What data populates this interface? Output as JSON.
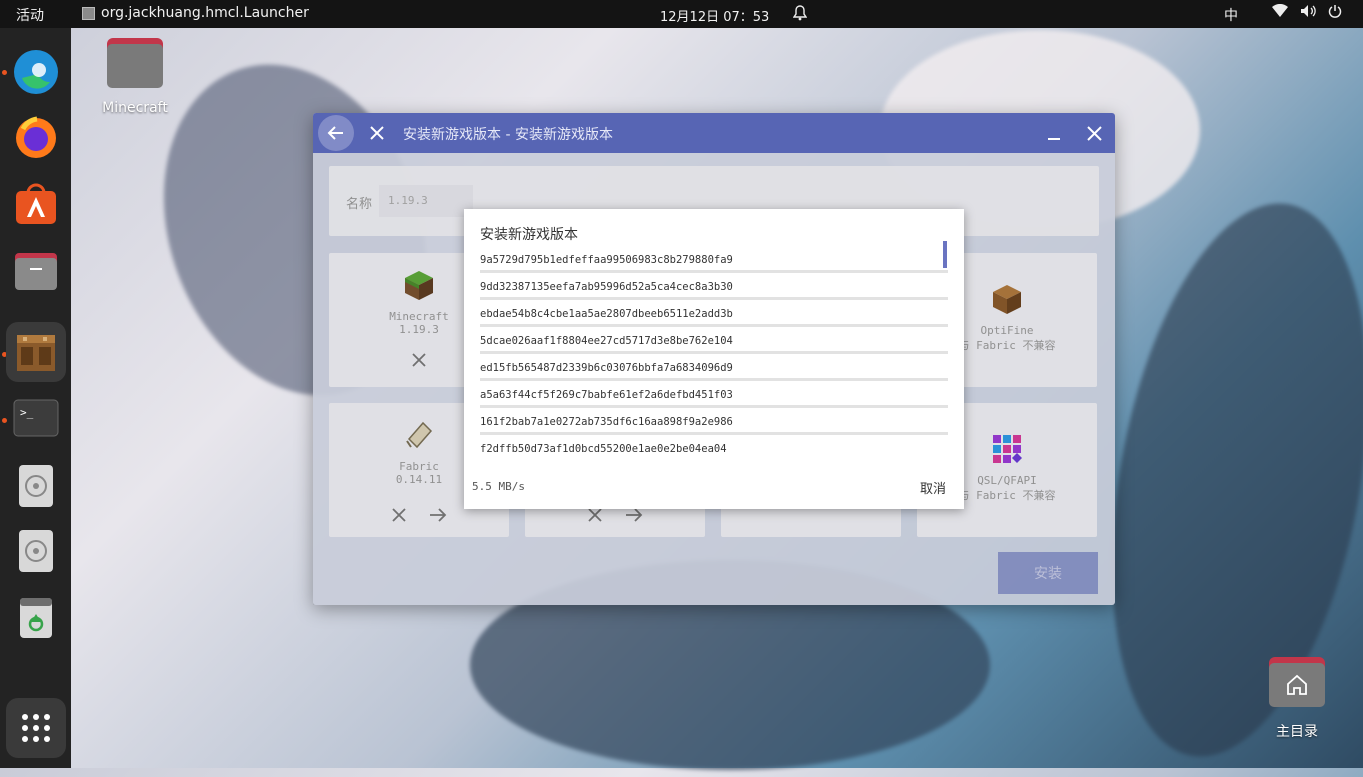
{
  "topbar": {
    "activities": "活动",
    "app_name": "org.jackhuang.hmcl.Launcher",
    "clock": "12月12日 07：53",
    "ime": "中"
  },
  "dock": {
    "items": [
      {
        "name": "edge",
        "running": true
      },
      {
        "name": "firefox",
        "running": false
      },
      {
        "name": "app-center",
        "running": false
      },
      {
        "name": "files",
        "running": false
      },
      {
        "name": "hmcl-launcher",
        "running": true
      },
      {
        "name": "terminal",
        "running": true
      },
      {
        "name": "disc-1",
        "running": false
      },
      {
        "name": "disc-2",
        "running": false
      },
      {
        "name": "trash",
        "running": false
      },
      {
        "name": "show-apps",
        "running": false
      }
    ]
  },
  "desktop": {
    "minecraft_label": "Minecraft",
    "home_label": "主目录"
  },
  "window": {
    "title": "安装新游戏版本 - 安装新游戏版本",
    "name_label": "名称",
    "name_value": "1.19.3",
    "cards": {
      "minecraft": {
        "name": "Minecraft",
        "version": "1.19.3"
      },
      "optifine": {
        "name": "OptiFine",
        "note": "与 Fabric 不兼容"
      },
      "fabric": {
        "name": "Fabric",
        "version": "0.14.11"
      },
      "qsl": {
        "name": "QSL/QFAPI",
        "note": "与 Fabric 不兼容"
      }
    },
    "install_label": "安装"
  },
  "dialog": {
    "title": "安装新游戏版本",
    "hashes": [
      "9a5729d795b1edfeffaa99506983c8b279880fa9",
      "9dd32387135eefa7ab95996d52a5ca4cec8a3b30",
      "ebdae54b8c4cbe1aa5ae2807dbeeb6511e2add3b",
      "5dcae026aaf1f8804ee27cd5717d3e8be762e104",
      "ed15fb565487d2339b6c03076bbfa7a6834096d9",
      "a5a63f44cf5f269c7babfe61ef2a6defbd451f03",
      "161f2bab7a1e0272ab735df6c16aa898f9a2e986",
      "f2dffb50d73af1d0bcd55200e1ae0e2be04ea04"
    ],
    "speed": "5.5 MB/s",
    "cancel_label": "取消"
  },
  "colors": {
    "accent": "#5765b4",
    "dock_dot": "#e95420",
    "topbar": "#141414"
  }
}
